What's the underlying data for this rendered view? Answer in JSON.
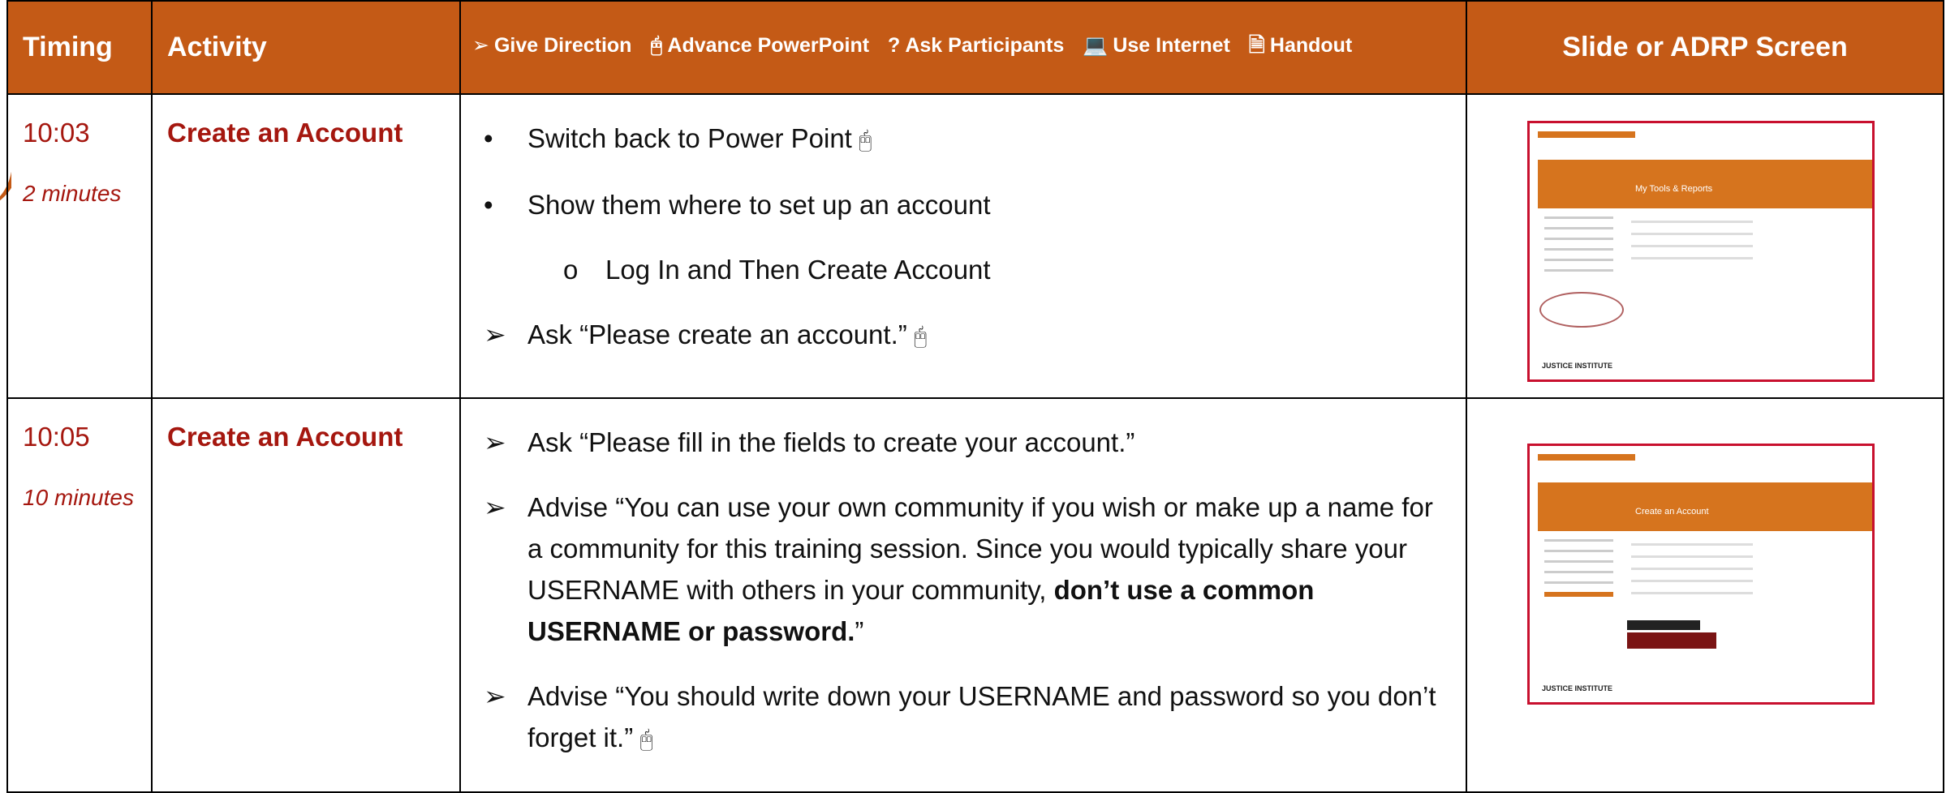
{
  "header": {
    "timing": "Timing",
    "activity": "Activity",
    "legend": [
      {
        "symbol": "➢",
        "label": "Give Direction"
      },
      {
        "symbol": "🖰",
        "label": "Advance PowerPoint"
      },
      {
        "symbol": "?",
        "label": "Ask Participants"
      },
      {
        "symbol": "💻",
        "label": "Use Internet"
      },
      {
        "symbol": "🗎",
        "label": "Handout"
      }
    ],
    "slide": "Slide or ADRP Screen"
  },
  "rows": [
    {
      "time": "10:03",
      "duration": "2 minutes",
      "activity": "Create an Account",
      "lines": [
        {
          "marker": "•",
          "text": "Switch back to Power Point",
          "mouse": "🖰"
        },
        {
          "marker": "•",
          "text": "Show them where to set up an account"
        },
        {
          "marker": "o",
          "text": "Log In and Then Create Account"
        },
        {
          "marker": "➢",
          "text": "Ask “Please create an account.”",
          "mouse": "🖰"
        }
      ],
      "thumb": {
        "title": "My Tools & Reports",
        "logo": "JUSTICE INSTITUTE"
      }
    },
    {
      "time": "10:05",
      "duration": "10 minutes",
      "activity": "Create an Account",
      "lines": [
        {
          "marker": "➢",
          "text": "Ask “Please fill in the fields to create your account.”"
        },
        {
          "marker": "➢",
          "text_a": "Advise “You can use your own community if you wish or make up a name for a community for this training session. Since you would typically share your USERNAME with others in your community, ",
          "text_bold": "don’t use a common USERNAME or password.",
          "text_b": "”"
        },
        {
          "marker": "➢",
          "text": "Advise “You should write down your USERNAME and password so you don’t forget it.”",
          "mouse": "🖰"
        }
      ],
      "thumb": {
        "title": "Create an Account",
        "logo": "JUSTICE INSTITUTE"
      }
    }
  ],
  "colors": {
    "header_bg": "#c45a16",
    "accent_red": "#a5170f",
    "thumb_border": "#c8102e"
  }
}
